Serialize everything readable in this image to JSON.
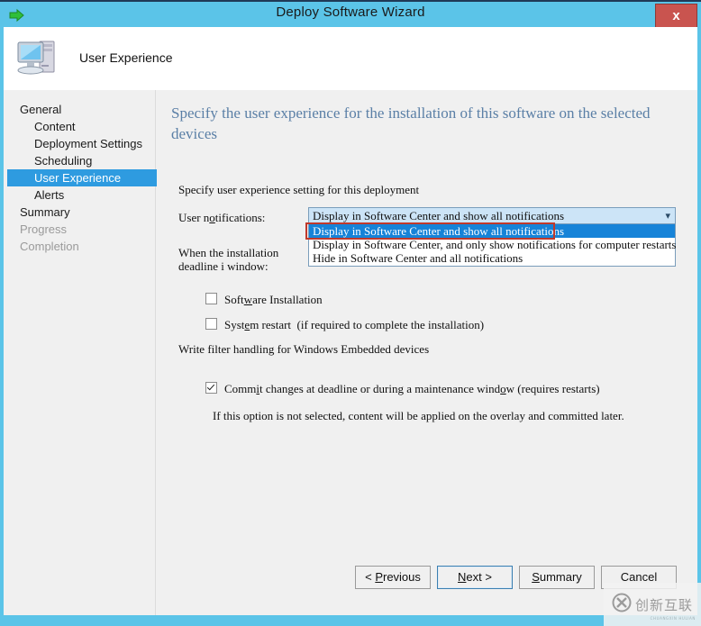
{
  "window": {
    "title": "Deploy Software Wizard",
    "title_icon": "green-arrow-icon",
    "close_label": "x",
    "accent_blue": "#5bc4e8",
    "highlight_blue": "#2e9be0",
    "annotation_red": "#c0392b"
  },
  "banner": {
    "icon": "computer-icon",
    "title": "User Experience"
  },
  "sidebar": {
    "items": [
      {
        "label": "General",
        "level": 0,
        "state": "normal"
      },
      {
        "label": "Content",
        "level": 1,
        "state": "normal"
      },
      {
        "label": "Deployment Settings",
        "level": 1,
        "state": "normal"
      },
      {
        "label": "Scheduling",
        "level": 1,
        "state": "normal"
      },
      {
        "label": "User Experience",
        "level": 1,
        "state": "active"
      },
      {
        "label": "Alerts",
        "level": 1,
        "state": "normal"
      },
      {
        "label": "Summary",
        "level": 0,
        "state": "normal"
      },
      {
        "label": "Progress",
        "level": 0,
        "state": "disabled"
      },
      {
        "label": "Completion",
        "level": 0,
        "state": "disabled"
      }
    ]
  },
  "main": {
    "heading": "Specify the user experience for the installation of this software on the selected devices",
    "instruction": "Specify user experience setting for this deployment",
    "user_notifications_label": "User notifications:",
    "deadline_label": "When the installation deadline is reached, allow the following activities to be performed outside the maintenance window:",
    "deadline_label_visible": "When the installation deadline i window:",
    "combo": {
      "selected": "Display in Software Center and show all notifications",
      "arrow_icon": "chevron-down-icon",
      "expanded": true,
      "options": [
        "Display in Software Center and show all notifications",
        "Display in Software Center, and only show notifications for computer restarts",
        "Hide in Software Center and all notifications"
      ],
      "highlighted_index": 0
    },
    "checkboxes": [
      {
        "label": "Software Installation",
        "checked": false
      },
      {
        "label": "System restart  (if required to complete the installation)",
        "checked": false
      }
    ],
    "write_filter_label": "Write filter handling for Windows Embedded devices",
    "commit_checkbox": {
      "label": "Commit changes at deadline or during a maintenance window (requires restarts)",
      "checked": true
    },
    "commit_help": "If this option is not selected, content will be applied on the overlay and committed later."
  },
  "footer": {
    "buttons": [
      {
        "label": "< Previous",
        "focused": false
      },
      {
        "label": "Next >",
        "focused": true
      },
      {
        "label": "Summary",
        "focused": false
      },
      {
        "label": "Cancel",
        "focused": false
      }
    ]
  },
  "watermark": {
    "text": "创新互联",
    "sub": "CHUANGXIN HULIAN",
    "logo_icon": "x-circle-logo-icon"
  }
}
